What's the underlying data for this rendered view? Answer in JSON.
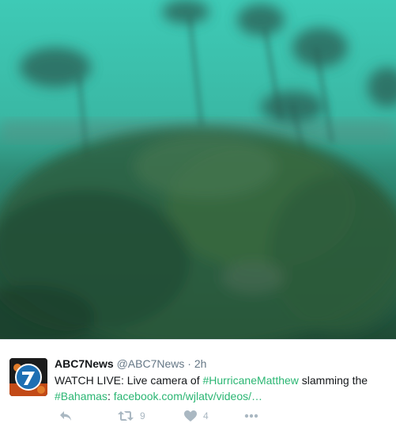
{
  "tweet": {
    "display_name": "ABC7News",
    "handle": "@ABC7News",
    "separator": "·",
    "time": "2h",
    "text_prefix": "WATCH LIVE: Live camera of ",
    "hashtag1": "#HurricaneMatthew",
    "text_middle": " slamming the",
    "hashtag2": "#Bahamas",
    "text_colon": ": ",
    "link": "facebook.com/wjlatv/videos/…"
  },
  "actions": {
    "reply_icon": "reply-icon",
    "retweet_icon": "retweet-icon",
    "retweet_count": "9",
    "like_icon": "heart-icon",
    "like_count": "4",
    "more_icon": "more-icon"
  },
  "colors": {
    "hashtag": "#2bb673",
    "action_gray": "#aab8c2"
  }
}
